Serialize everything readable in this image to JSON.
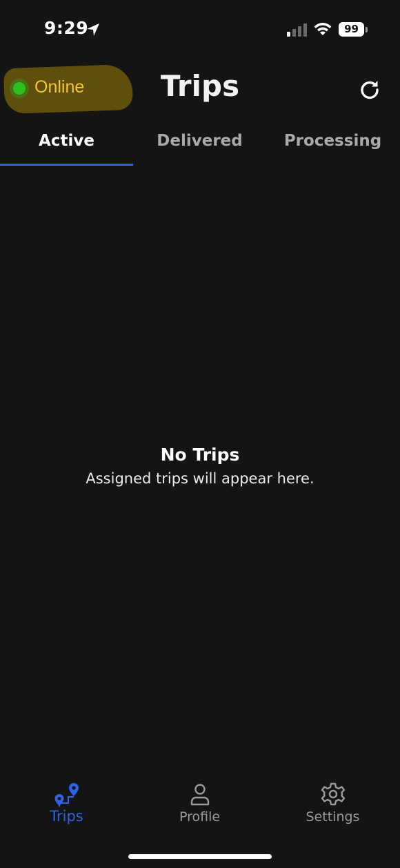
{
  "status_bar": {
    "time": "9:29",
    "battery": "99"
  },
  "header": {
    "status_label": "Online",
    "title": "Trips",
    "status_color": "#27c21c",
    "status_text_color": "#f3c530"
  },
  "tabs": [
    {
      "label": "Active",
      "active": true
    },
    {
      "label": "Delivered",
      "active": false
    },
    {
      "label": "Processing",
      "active": false
    }
  ],
  "empty_state": {
    "title": "No Trips",
    "subtitle": "Assigned trips will appear here."
  },
  "bottom_nav": {
    "items": [
      {
        "label": "Trips",
        "icon": "map-pins-icon",
        "active": true
      },
      {
        "label": "Profile",
        "icon": "person-icon",
        "active": false
      },
      {
        "label": "Settings",
        "icon": "gear-icon",
        "active": false
      }
    ]
  },
  "colors": {
    "accent": "#2f62e6",
    "background": "#141414"
  }
}
